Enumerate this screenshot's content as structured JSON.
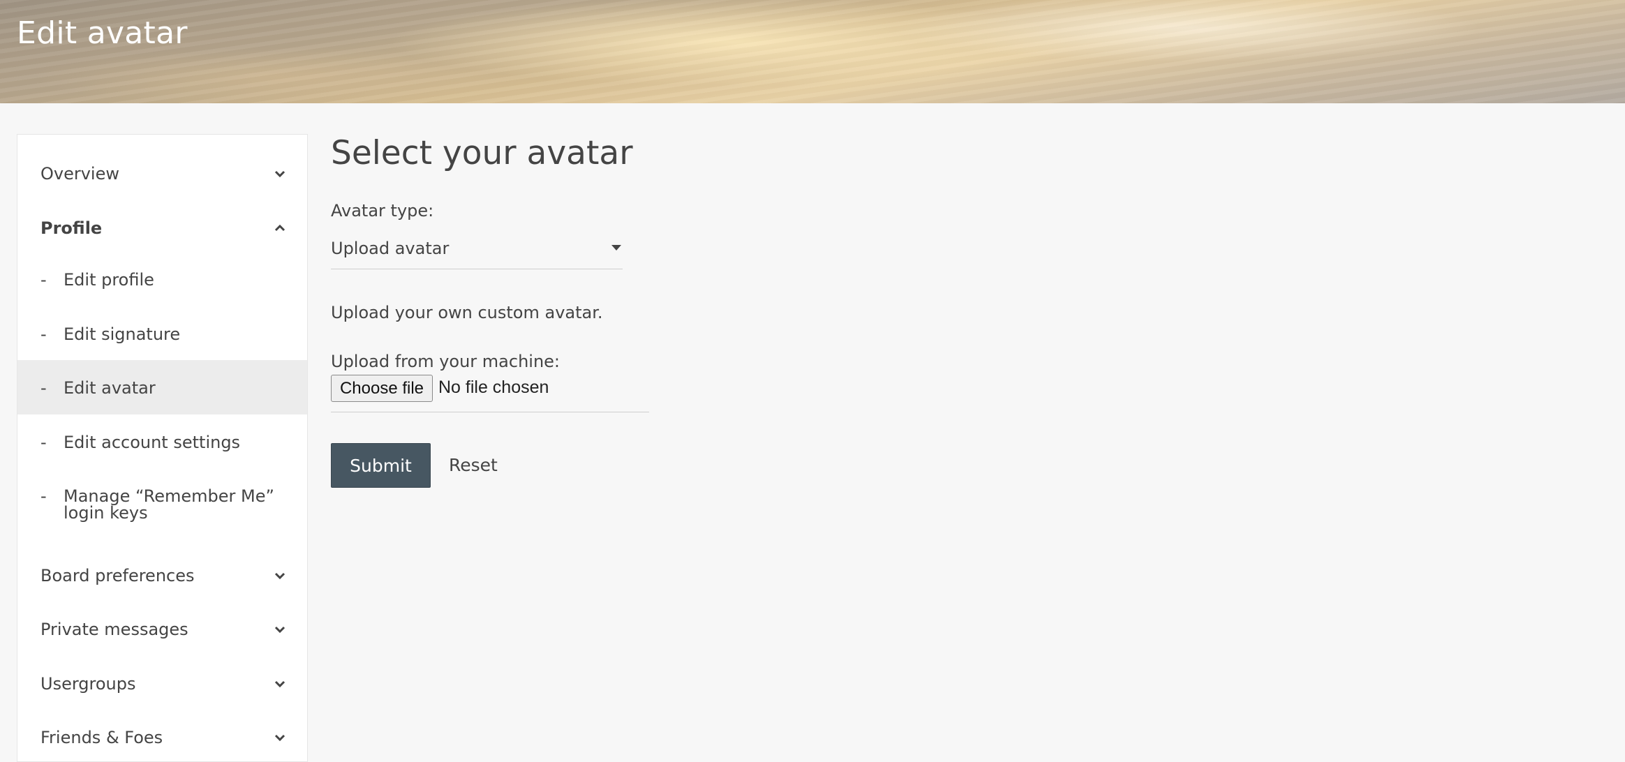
{
  "header": {
    "title": "Edit avatar"
  },
  "sidebar": {
    "sections": [
      {
        "label": "Overview",
        "state": "collapsed"
      },
      {
        "label": "Profile",
        "state": "expanded"
      },
      {
        "label": "Board preferences",
        "state": "collapsed"
      },
      {
        "label": "Private messages",
        "state": "collapsed"
      },
      {
        "label": "Usergroups",
        "state": "collapsed"
      },
      {
        "label": "Friends & Foes",
        "state": "collapsed"
      }
    ],
    "profile_items": [
      {
        "dash": "-",
        "label": "Edit profile"
      },
      {
        "dash": "-",
        "label": "Edit signature"
      },
      {
        "dash": "-",
        "label": "Edit avatar",
        "active": true
      },
      {
        "dash": "-",
        "label": "Edit account settings"
      },
      {
        "dash": "-",
        "label": "Manage “Remember Me” login keys"
      }
    ]
  },
  "main": {
    "title": "Select your avatar",
    "avatar_type_label": "Avatar type:",
    "avatar_type_value": "Upload avatar",
    "upload_description": "Upload your own custom avatar.",
    "upload_label": "Upload from your machine:",
    "choose_file_label": "Choose file",
    "file_status": "No file chosen",
    "submit_label": "Submit",
    "reset_label": "Reset"
  },
  "colors": {
    "submit_bg": "#475762",
    "page_bg": "#f7f7f7",
    "active_item_bg": "#ececec"
  },
  "icons": {
    "collapsed": "chevron-down-icon",
    "expanded": "chevron-up-icon",
    "select": "caret-down-icon"
  }
}
